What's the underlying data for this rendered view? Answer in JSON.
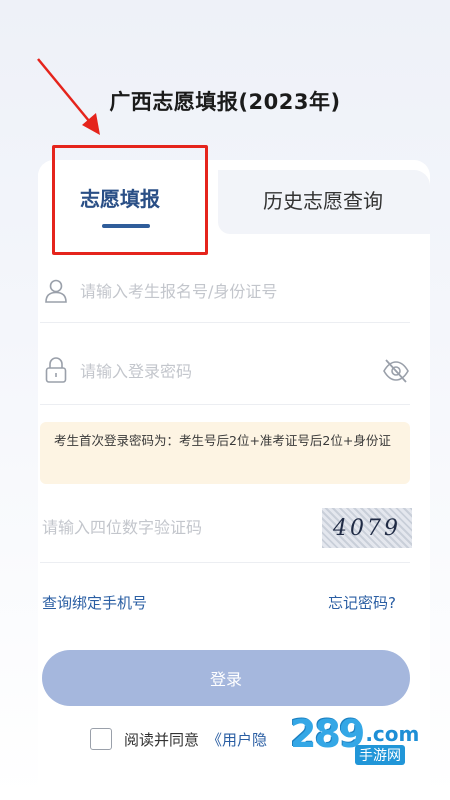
{
  "page": {
    "title": "广西志愿填报(2023年)"
  },
  "tabs": [
    {
      "label": "志愿填报",
      "active": true
    },
    {
      "label": "历史志愿查询",
      "active": false
    }
  ],
  "form": {
    "exam_id": {
      "placeholder": "请输入考生报名号/身份证号",
      "value": ""
    },
    "password": {
      "placeholder": "请输入登录密码",
      "value": ""
    },
    "notice": "考生首次登录密码为：考生号后2位+准考证号后2位+身份证",
    "captcha_input": {
      "placeholder": "请输入四位数字验证码",
      "value": ""
    },
    "captcha_image_text": "4079"
  },
  "links": {
    "bind_phone": "查询绑定手机号",
    "forgot_password": "忘记密码?"
  },
  "buttons": {
    "login": "登录"
  },
  "agreement": {
    "prefix": "阅读并同意",
    "link": "《用户隐",
    "checked": false
  },
  "watermark": {
    "number": "289",
    "domain": ".com",
    "sub": "手游网"
  },
  "icons": {
    "user": "user-icon",
    "lock": "lock-icon",
    "eye_off": "eye-off-icon",
    "arrow": "arrow-icon",
    "checkbox": "checkbox-icon"
  },
  "colors": {
    "accent": "#2a5ea3",
    "tab_active": "#2a4f86",
    "highlight": "#e5241c",
    "login_button": "#a5b7dd",
    "notice_bg": "#fdf4e3"
  }
}
